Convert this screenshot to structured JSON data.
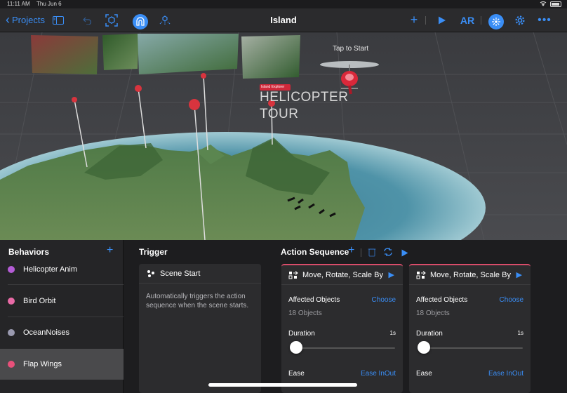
{
  "status": {
    "time": "11:11 AM",
    "date": "Thu Jun 6"
  },
  "toolbar": {
    "back_label": "Projects",
    "title": "Island",
    "ar_label": "AR",
    "icons": [
      "sidebar-icon",
      "undo-icon",
      "scene-select-icon",
      "anchor-icon",
      "object-icon",
      "plus-icon",
      "play-icon",
      "behaviors-icon",
      "settings-icon",
      "more-icon"
    ]
  },
  "scene": {
    "tap_to_start": "Tap to Start",
    "sign_small": "Island Explorer",
    "sign_line1": "HELICOPTER",
    "sign_line2": "TOUR"
  },
  "behaviors": {
    "title": "Behaviors",
    "items": [
      {
        "label": "Helicopter Anim",
        "color": "#b45cd6"
      },
      {
        "label": "Bird Orbit",
        "color": "#e86aa6"
      },
      {
        "label": "OceanNoises",
        "color": "#9a9ab0"
      },
      {
        "label": "Flap Wings",
        "color": "#e8507a",
        "selected": true
      }
    ]
  },
  "trigger": {
    "title": "Trigger",
    "card_title": "Scene Start",
    "description": "Automatically triggers the action sequence when the scene starts."
  },
  "action_sequence": {
    "title": "Action Sequence",
    "cards": [
      {
        "title": "Move, Rotate, Scale By",
        "affected_label": "Affected Objects",
        "choose_label": "Choose",
        "objects_count": "18 Objects",
        "duration_label": "Duration",
        "duration_value": "1s",
        "duration_fraction": 0.0,
        "ease_label": "Ease",
        "ease_value": "Ease InOut"
      },
      {
        "title": "Move, Rotate, Scale By",
        "affected_label": "Affected Objects",
        "choose_label": "Choose",
        "objects_count": "18 Objects",
        "duration_label": "Duration",
        "duration_value": "1s",
        "duration_fraction": 0.0,
        "ease_label": "Ease",
        "ease_value": "Ease InOut"
      }
    ]
  },
  "colors": {
    "accent": "#3a8ef6",
    "action_bar": "#d94c6a"
  }
}
